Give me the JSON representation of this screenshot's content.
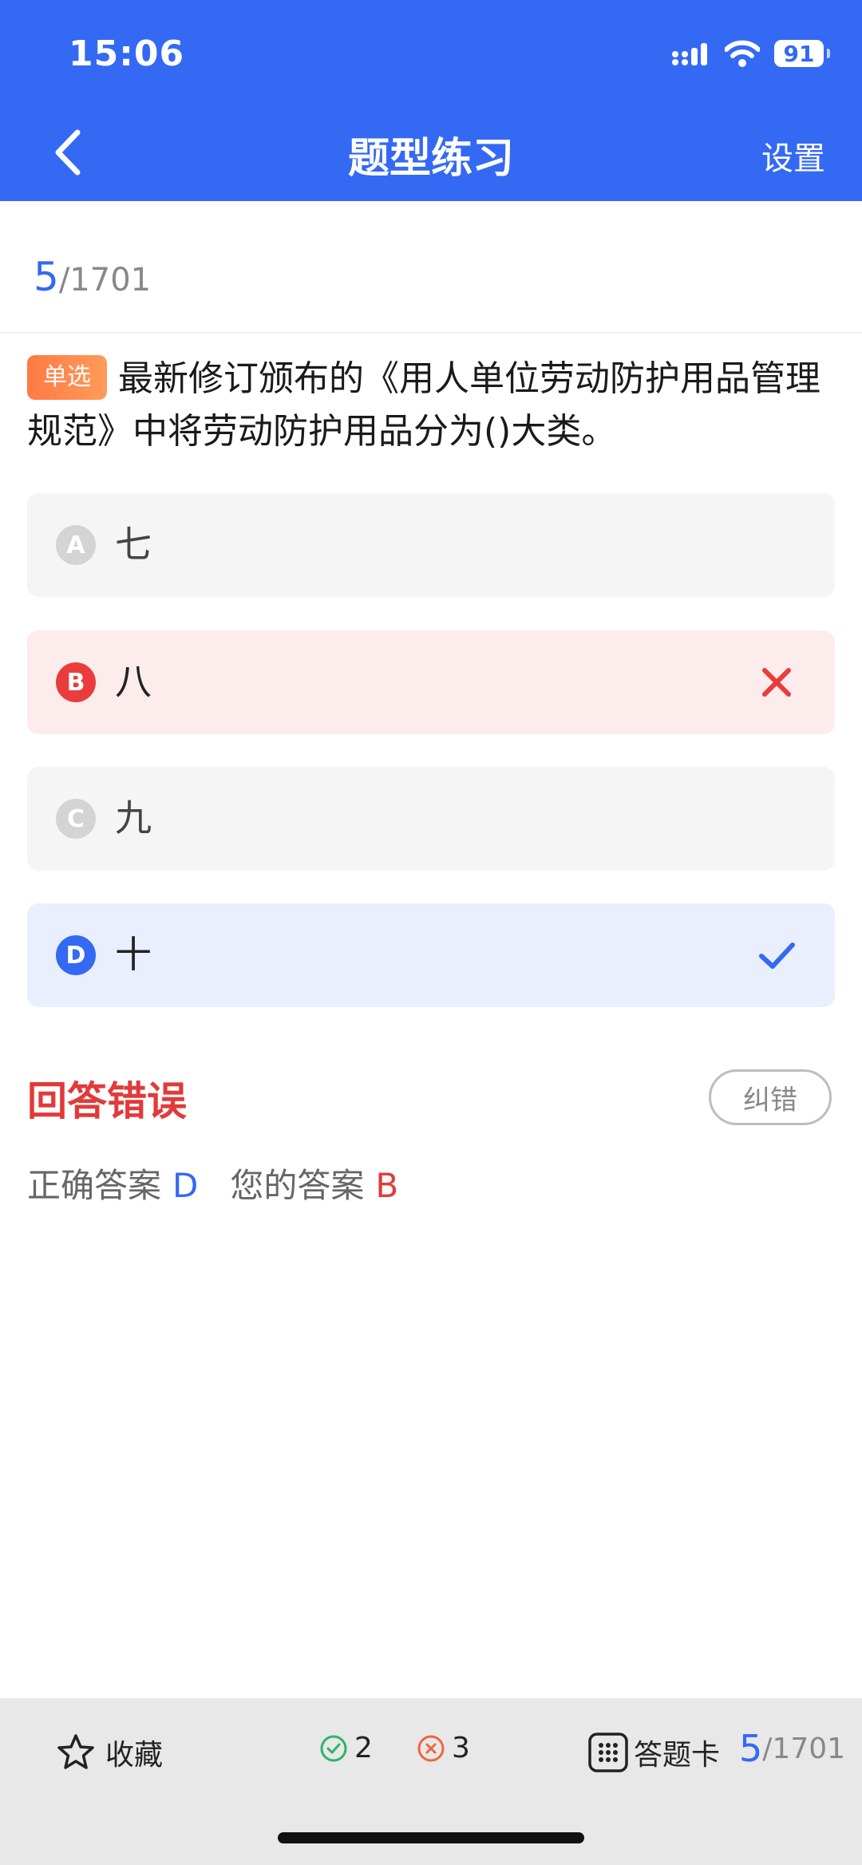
{
  "status_bar": {
    "time": "15:06",
    "battery": "91"
  },
  "header": {
    "title": "题型练习",
    "settings_label": "设置"
  },
  "progress": {
    "current": "5",
    "total": "/1701"
  },
  "question": {
    "type_tag": "单选",
    "text": "最新修订颁布的《用人单位劳动防护用品管理规范》中将劳动防护用品分为()大类。"
  },
  "options": [
    {
      "letter": "A",
      "text": "七",
      "state": "neutral"
    },
    {
      "letter": "B",
      "text": "八",
      "state": "wrong"
    },
    {
      "letter": "C",
      "text": "九",
      "state": "neutral"
    },
    {
      "letter": "D",
      "text": "十",
      "state": "correct"
    }
  ],
  "result": {
    "title": "回答错误",
    "report_label": "纠错",
    "correct_label": "正确答案",
    "correct_value": "D",
    "user_label": "您的答案",
    "user_value": "B"
  },
  "bottom_bar": {
    "favorite_label": "收藏",
    "correct_count": "2",
    "wrong_count": "3",
    "answer_card_label": "答题卡",
    "current": "5",
    "total": "/1701"
  },
  "colors": {
    "primary": "#3469f4",
    "error": "#e23a3a",
    "tag": "#ff7a45",
    "correct_green": "#2fb36a"
  },
  "icons": [
    "back-chevron-icon",
    "signal-icon",
    "wifi-icon",
    "battery-icon",
    "close-icon",
    "check-icon",
    "star-icon",
    "check-circle-icon",
    "x-circle-icon",
    "grid-icon"
  ]
}
